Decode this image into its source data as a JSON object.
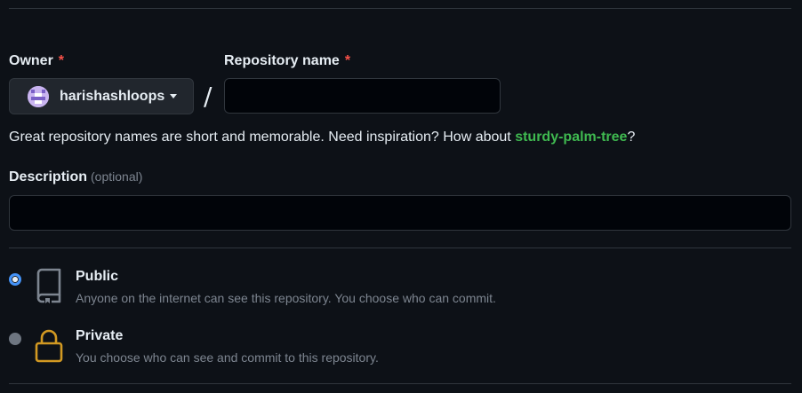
{
  "owner": {
    "label": "Owner",
    "required_marker": "*",
    "username": "harishashloops"
  },
  "repo": {
    "label": "Repository name",
    "required_marker": "*",
    "value": "",
    "separator": "/"
  },
  "hint": {
    "text": "Great repository names are short and memorable. Need inspiration? How about ",
    "suggestion": "sturdy-palm-tree",
    "end": "?"
  },
  "description": {
    "label": "Description",
    "optional": "(optional)",
    "value": ""
  },
  "visibility": {
    "public": {
      "title": "Public",
      "desc": "Anyone on the internet can see this repository. You choose who can commit.",
      "selected": true,
      "icon": "repo-book-icon"
    },
    "private": {
      "title": "Private",
      "desc": "You choose who can see and commit to this repository.",
      "selected": false,
      "icon": "lock-icon"
    }
  },
  "colors": {
    "background": "#0d1117",
    "required": "#f85149",
    "suggestion": "#3fb950",
    "radio_selected": "#4493f8",
    "lock": "#d29922"
  }
}
